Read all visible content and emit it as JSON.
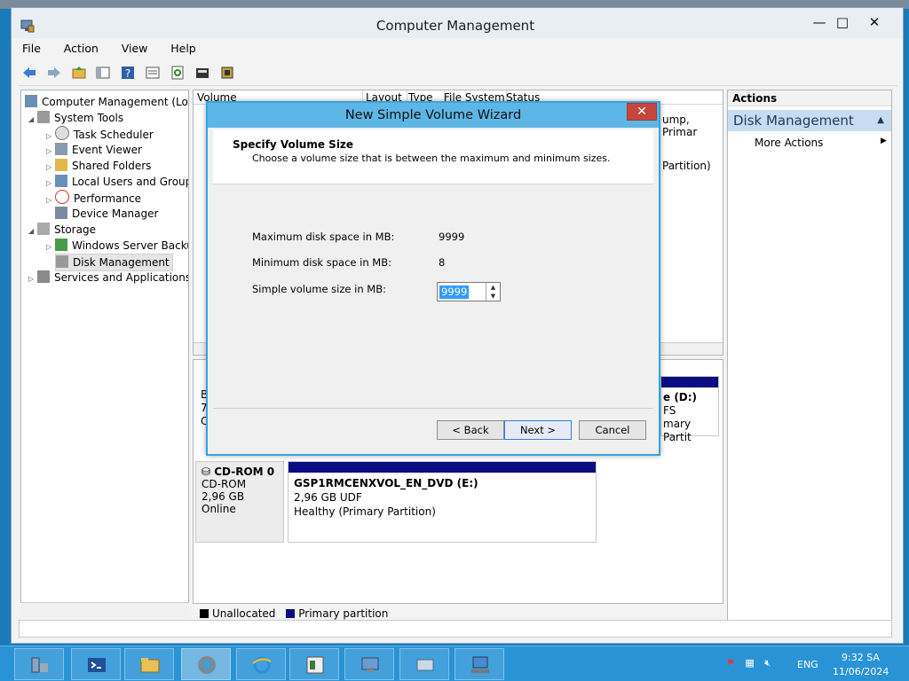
{
  "window": {
    "title": "Computer Management",
    "controls": {
      "minimize": "—",
      "maximize": "□",
      "close": "✕"
    }
  },
  "menu": [
    "File",
    "Action",
    "View",
    "Help"
  ],
  "tree": {
    "root": "Computer Management (Local",
    "system_tools": "System Tools",
    "items": [
      "Task Scheduler",
      "Event Viewer",
      "Shared Folders",
      "Local Users and Groups",
      "Performance",
      "Device Manager"
    ],
    "storage": "Storage",
    "storage_items": [
      "Windows Server Backup",
      "Disk Management"
    ],
    "services": "Services and Applications"
  },
  "volume_list": {
    "columns": [
      "Volume",
      "Layout",
      "Type",
      "File System",
      "Status"
    ],
    "right_text_1": "ump, Primar",
    "right_text_2": "Partition)"
  },
  "disk_map": {
    "disk0_fragments": [
      "B",
      "7",
      "C"
    ],
    "part_right": {
      "line1": "e  (D:)",
      "line2": "FS",
      "line3": "mary Partit"
    },
    "cdrom": {
      "name": "CD-ROM 0",
      "type": "CD-ROM",
      "size": "2,96 GB",
      "status": "Online",
      "volume_name": "GSP1RMCENXVOL_EN_DVD  (E:)",
      "volume_size": "2,96 GB UDF",
      "volume_status": "Healthy (Primary Partition)"
    },
    "legend": [
      {
        "label": "Unallocated",
        "color": "#000000"
      },
      {
        "label": "Primary partition",
        "color": "#0c0c82"
      }
    ]
  },
  "actions": {
    "header": "Actions",
    "section": "Disk Management",
    "item": "More Actions"
  },
  "dialog": {
    "title": "New Simple Volume Wizard",
    "close": "✕",
    "heading": "Specify Volume Size",
    "subheading": "Choose a volume size that is between the maximum and minimum sizes.",
    "max_label": "Maximum disk space in MB:",
    "max_value": "9999",
    "min_label": "Minimum disk space in MB:",
    "min_value": "8",
    "size_label": "Simple volume size in MB:",
    "size_value": "9999",
    "buttons": {
      "back": "< Back",
      "next": "Next >",
      "cancel": "Cancel"
    }
  },
  "tray": {
    "lang": "ENG",
    "time": "9:32 SA",
    "date": "11/06/2024"
  },
  "colors": {
    "accent": "#33a5dd",
    "taskbar": "#2a93d5",
    "partition": "#0c0c82"
  }
}
